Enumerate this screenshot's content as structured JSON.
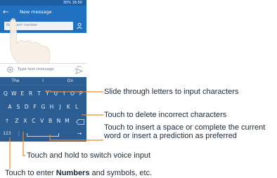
{
  "phone": {
    "status_text": "30% 16:50",
    "title": "New message",
    "recipient_placeholder": "Recipient number",
    "message_placeholder": "Type text message",
    "send_label": "MMS"
  },
  "keyboard": {
    "suggestions": [
      "The",
      "I",
      "On"
    ],
    "row1": [
      "Q",
      "W",
      "E",
      "R",
      "T",
      "Y",
      "U",
      "I",
      "O",
      "P"
    ],
    "row2": [
      "A",
      "S",
      "D",
      "F",
      "G",
      "H",
      "J",
      "K",
      "L"
    ],
    "row3": [
      "Z",
      "X",
      "C",
      "V",
      "B",
      "N",
      "M"
    ],
    "numbers_key": "123"
  },
  "callouts": {
    "slide": "Slide through letters to input characters",
    "delete": "Touch to delete incorrect characters",
    "space": "Touch to insert a space or complete the current word or insert a prediction as preferred",
    "voice": "Touch and hold to switch voice input",
    "numbers_pre": "Touch to enter ",
    "numbers_bold": "Numbers",
    "numbers_post": " and symbols, etc."
  },
  "colors": {
    "keyboard": "#2b5d93",
    "appbar": "#2171c1",
    "leader": "#f0892c"
  }
}
